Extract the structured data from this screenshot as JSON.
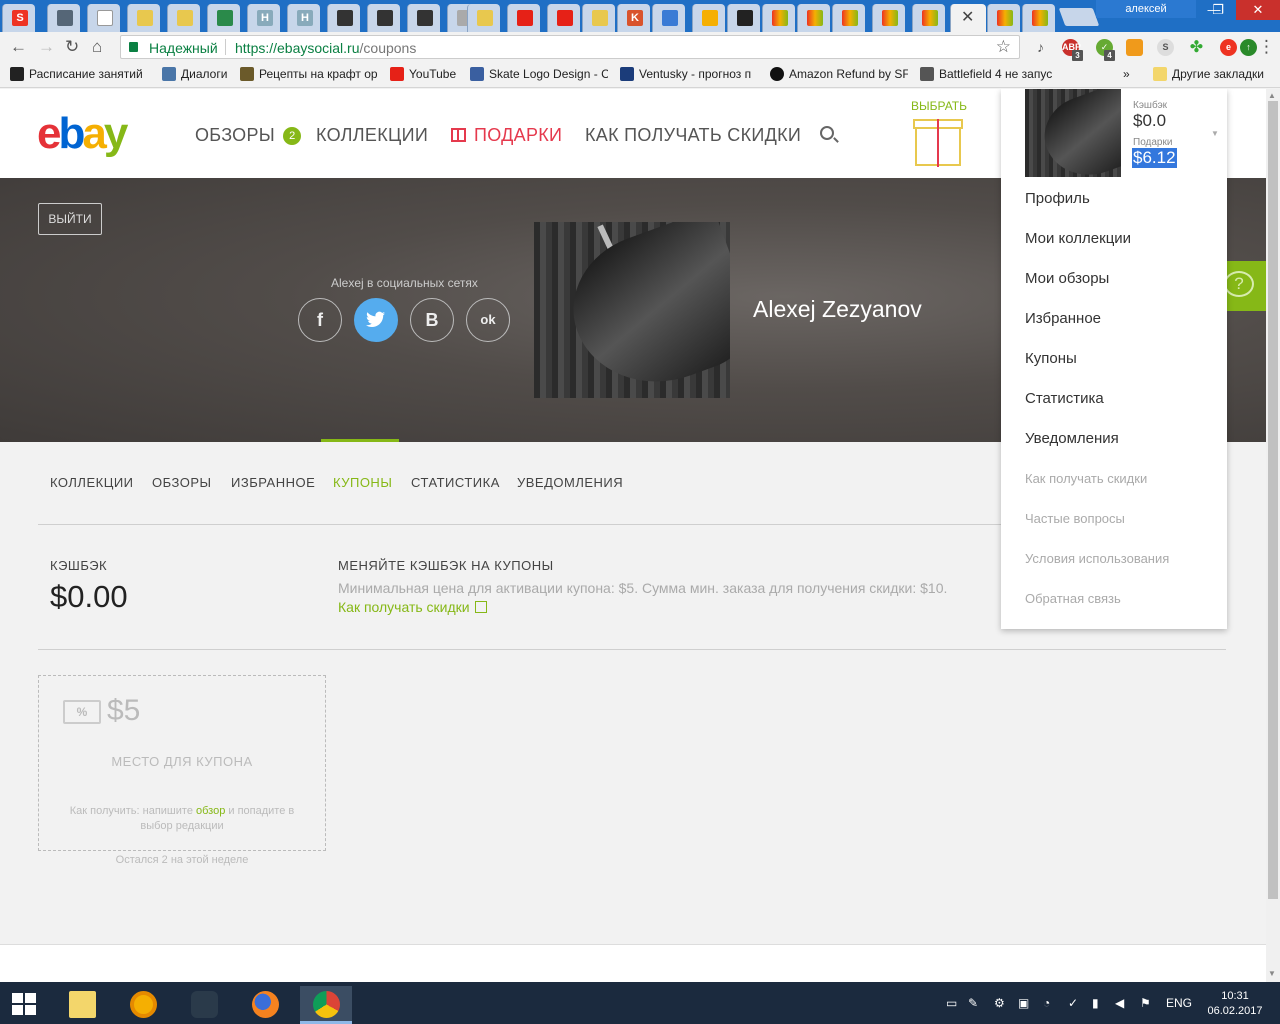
{
  "browser": {
    "user": "алексей",
    "win_min": "—",
    "win_max": "❐",
    "win_close": "✕",
    "tab_close": "✕",
    "security_label": "Надежный",
    "url_host": "https://ebaysocial.ru",
    "url_path": "/coupons",
    "ext_abp_count": "3",
    "ext_shield_count": "4",
    "ext_abp_label": "ABP"
  },
  "bookmarks": [
    {
      "label": "Расписание занятий",
      "color": "#222222"
    },
    {
      "label": "Диалоги",
      "color": "#4a76a8"
    },
    {
      "label": "Рецепты на крафт ор",
      "color": "#6b5a2a"
    },
    {
      "label": "YouTube",
      "color": "#e62117"
    },
    {
      "label": "Skate Logo Design - C",
      "color": "#3a5fa0"
    },
    {
      "label": "Ventusky - прогноз п",
      "color": "#1b3c7a"
    },
    {
      "label": "Amazon Refund by SF",
      "color": "#111111"
    },
    {
      "label": "Battlefield 4 не запус",
      "color": "#555555"
    },
    {
      "label": "»",
      "color": ""
    },
    {
      "label": "Другие закладки",
      "color": "#f3d66b"
    }
  ],
  "site": {
    "logo": {
      "e": "e",
      "b": "b",
      "a": "a",
      "y": "y"
    },
    "nav": {
      "reviews": "ОБЗОРЫ",
      "reviews_badge": "2",
      "collections": "КОЛЛЕКЦИИ",
      "gifts": "ПОДАРКИ",
      "discounts": "КАК ПОЛУЧАТЬ СКИДКИ"
    },
    "choose_label": "ВЫБРАТЬ"
  },
  "profile": {
    "logout": "ВЫЙТИ",
    "social_caption": "Alexej в социальных сетях",
    "social": [
      "f",
      "",
      "B",
      "ok"
    ],
    "name": "Alexej Zezyanov"
  },
  "tabs": [
    "КОЛЛЕКЦИИ",
    "ОБЗОРЫ",
    "ИЗБРАННОЕ",
    "КУПОНЫ",
    "СТАТИСТИКА",
    "УВЕДОМЛЕНИЯ"
  ],
  "active_tab": "КУПОНЫ",
  "cashback": {
    "label": "КЭШБЭК",
    "value": "$0.00",
    "exchange_title": "МЕНЯЙТЕ КЭШБЭК НА КУПОНЫ",
    "exchange_desc": "Минимальная цена для активации купона: $5. Сумма мин. заказа для получения скидки: $10.",
    "exchange_link": "Как получать скидки"
  },
  "coupon": {
    "ticket": "%",
    "amount": "$5",
    "placeholder": "МЕСТО ДЛЯ КУПОНА",
    "how_prefix": "Как получить: напишите ",
    "how_link": "обзор",
    "how_suffix": " и попадите в выбор редакции",
    "remaining": "Остался 2 на этой неделе"
  },
  "help": {
    "symbol": "?"
  },
  "dropdown": {
    "cashback_label": "Кэшбэк",
    "cashback_value": "$0.0",
    "gifts_label": "Подарки",
    "gifts_value": "$6.12",
    "items": [
      "Профиль",
      "Мои коллекции",
      "Мои обзоры",
      "Избранное",
      "Купоны",
      "Статистика",
      "Уведомления"
    ],
    "secondary": [
      "Как получать скидки",
      "Частые вопросы",
      "Условия использования",
      "Обратная связь"
    ]
  },
  "taskbar": {
    "lang": "ENG",
    "time": "10:31",
    "date": "06.02.2017"
  },
  "colors": {
    "accent": "#86b817",
    "gift": "#e5394d",
    "twitter": "#55acee"
  }
}
